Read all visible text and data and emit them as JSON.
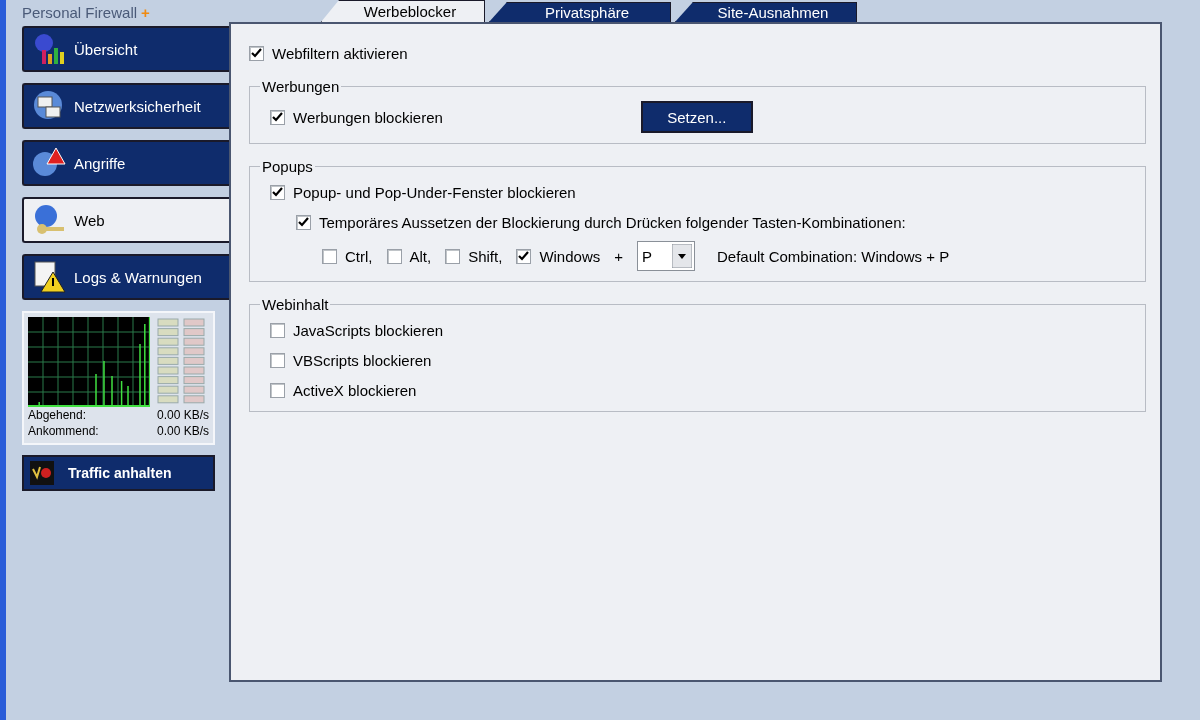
{
  "app": {
    "logo": "Personal Firewall",
    "logo_plus": "+"
  },
  "nav": [
    {
      "label": "Übersicht",
      "selected": false
    },
    {
      "label": "Netzwerksicherheit",
      "selected": false
    },
    {
      "label": "Angriffe",
      "selected": false
    },
    {
      "label": "Web",
      "selected": true
    },
    {
      "label": "Logs & Warnungen",
      "selected": false
    }
  ],
  "traffic": {
    "outgoing_label": "Abgehend:",
    "outgoing_value": "0.00 KB/s",
    "incoming_label": "Ankommend:",
    "incoming_value": "0.00 KB/s"
  },
  "stop_button": "Traffic anhalten",
  "tabs": [
    {
      "label": "Werbeblocker",
      "selected": true
    },
    {
      "label": "Privatsphäre",
      "selected": false
    },
    {
      "label": "Site-Ausnahmen",
      "selected": false
    }
  ],
  "enable": {
    "label": "Webfiltern aktivieren",
    "checked": true
  },
  "groups": [
    {
      "title": "Werbungen",
      "rows": [
        {
          "kind": "check_button",
          "label": "Werbungen blockieren",
          "checked": true,
          "button": "Setzen..."
        }
      ]
    },
    {
      "title": "Popups",
      "rows": [
        {
          "kind": "check",
          "label": "Popup- und Pop-Under-Fenster blockieren",
          "checked": true
        },
        {
          "kind": "subcheck",
          "label": "Temporäres Aussetzen der Blockierung durch Drücken folgender Tasten-Kombinationen:",
          "checked": true
        },
        {
          "kind": "keys",
          "keys": [
            {
              "label": "Ctrl,",
              "checked": false
            },
            {
              "label": "Alt,",
              "checked": false
            },
            {
              "label": "Shift,",
              "checked": false
            },
            {
              "label": "Windows",
              "checked": true
            }
          ],
          "plus": "+",
          "select": "P",
          "default": "Default Combination: Windows + P"
        }
      ]
    },
    {
      "title": "Webinhalt",
      "rows": [
        {
          "kind": "check",
          "label": "JavaScripts blockieren",
          "checked": false
        },
        {
          "kind": "check",
          "label": "VBScripts blockieren",
          "checked": false
        },
        {
          "kind": "check",
          "label": "ActiveX blockieren",
          "checked": false
        }
      ]
    }
  ]
}
